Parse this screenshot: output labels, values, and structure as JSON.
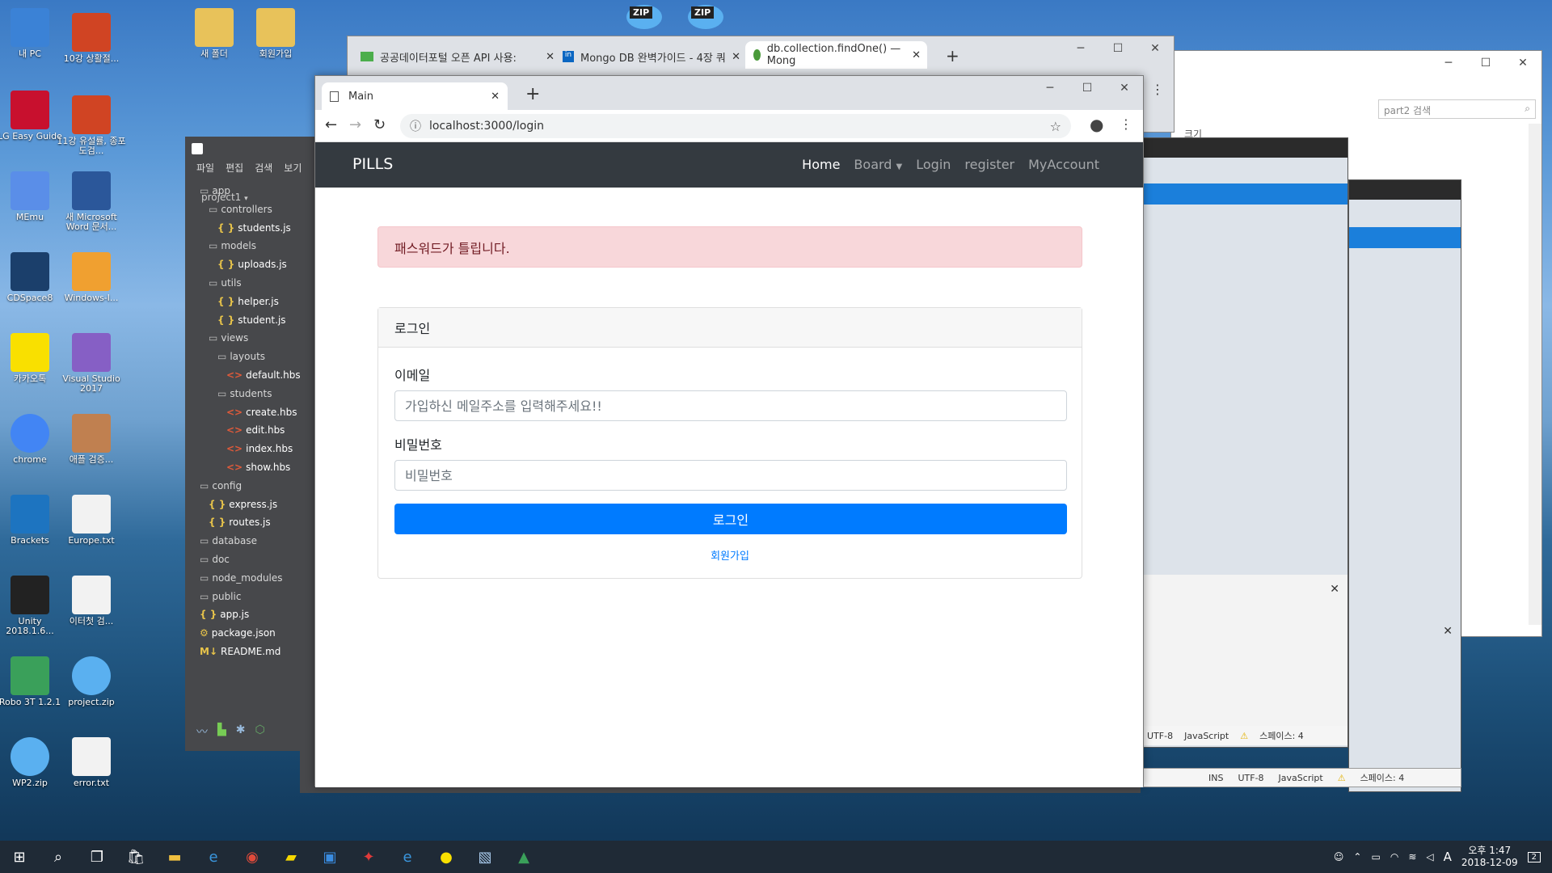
{
  "desktop_icons": [
    {
      "label": "내 PC",
      "icon": "pc-icon",
      "color": "#3b82d6"
    },
    {
      "label": "10강 상활절...",
      "icon": "ppt-icon",
      "color": "#d04423"
    },
    {
      "label": "새 폴더",
      "icon": "folder-icon",
      "color": "#e8c25a"
    },
    {
      "label": "회원가입",
      "icon": "folder-icon",
      "color": "#e8c25a"
    },
    {
      "label": "LG Easy Guide",
      "icon": "lg-icon",
      "color": "#c8102e"
    },
    {
      "label": "11강 유설률, 종포도검...",
      "icon": "ppt-icon",
      "color": "#d04423"
    },
    {
      "label": "MEmu",
      "icon": "memu-icon",
      "color": "#5a8ee8"
    },
    {
      "label": "새 Microsoft Word 문서...",
      "icon": "word-icon",
      "color": "#2b579a"
    },
    {
      "label": "CDSpace8",
      "icon": "cdspace-icon",
      "color": "#1b3f6b"
    },
    {
      "label": "Windows-I...",
      "icon": "helpdoc-icon",
      "color": "#f0a030"
    },
    {
      "label": "카카오톡",
      "icon": "kakaotalk-icon",
      "color": "#f9e000"
    },
    {
      "label": "Visual Studio 2017",
      "icon": "visual-studio-icon",
      "color": "#865fc5"
    },
    {
      "label": "chrome",
      "icon": "chrome-icon",
      "color": "#4285f4"
    },
    {
      "label": "애플 검증...",
      "icon": "image-icon",
      "color": "#c08050"
    },
    {
      "label": "Brackets",
      "icon": "brackets-icon",
      "color": "#1d74c0"
    },
    {
      "label": "Europe.txt",
      "icon": "text-file-icon",
      "color": "#f2f2f2"
    },
    {
      "label": "Unity 2018.1.6...",
      "icon": "unity-icon",
      "color": "#222222"
    },
    {
      "label": "이터첫 검...",
      "icon": "text-file-icon",
      "color": "#f2f2f2"
    },
    {
      "label": "Robo 3T 1.2.1",
      "icon": "robo3t-icon",
      "color": "#3aa05a"
    },
    {
      "label": "project.zip",
      "icon": "zip-icon",
      "color": "#5ab0f0"
    },
    {
      "label": "WP2.zip",
      "icon": "zip-icon",
      "color": "#5ab0f0"
    },
    {
      "label": "error.txt",
      "icon": "text-file-icon",
      "color": "#f2f2f2"
    }
  ],
  "top_zips": [
    "ZIP",
    "ZIP"
  ],
  "back_browser": {
    "tabs": [
      "공공데이터포털 오픈 API 사용:",
      "Mongo DB 완벽가이드 - 4장 쿼",
      "db.collection.findOne() — Mong"
    ]
  },
  "explorer": {
    "search_placeholder": "part2 검색",
    "text": "크기"
  },
  "editor": {
    "menu": [
      "파일",
      "편집",
      "검색",
      "보기"
    ],
    "project": "project1",
    "tree": [
      {
        "label": "app",
        "type": "folder",
        "depth": 0
      },
      {
        "label": "controllers",
        "type": "folder",
        "depth": 1
      },
      {
        "label": "students.js",
        "type": "js",
        "depth": 2
      },
      {
        "label": "models",
        "type": "folder",
        "depth": 1
      },
      {
        "label": "uploads.js",
        "type": "js",
        "depth": 2
      },
      {
        "label": "utils",
        "type": "folder",
        "depth": 1
      },
      {
        "label": "helper.js",
        "type": "js",
        "depth": 2
      },
      {
        "label": "student.js",
        "type": "js",
        "depth": 2
      },
      {
        "label": "views",
        "type": "folder",
        "depth": 1
      },
      {
        "label": "layouts",
        "type": "folder",
        "depth": 2
      },
      {
        "label": "default.hbs",
        "type": "hbs",
        "depth": 3
      },
      {
        "label": "students",
        "type": "folder",
        "depth": 2
      },
      {
        "label": "create.hbs",
        "type": "hbs",
        "depth": 3
      },
      {
        "label": "edit.hbs",
        "type": "hbs",
        "depth": 3
      },
      {
        "label": "index.hbs",
        "type": "hbs",
        "depth": 3
      },
      {
        "label": "show.hbs",
        "type": "hbs",
        "depth": 3
      },
      {
        "label": "config",
        "type": "folder",
        "depth": 0
      },
      {
        "label": "express.js",
        "type": "js",
        "depth": 1
      },
      {
        "label": "routes.js",
        "type": "js",
        "depth": 1
      },
      {
        "label": "database",
        "type": "folder",
        "depth": 0
      },
      {
        "label": "doc",
        "type": "folder",
        "depth": 0
      },
      {
        "label": "node_modules",
        "type": "folder",
        "depth": 0
      },
      {
        "label": "public",
        "type": "folder",
        "depth": 0
      },
      {
        "label": "app.js",
        "type": "js",
        "depth": 0
      },
      {
        "label": "package.json",
        "type": "json",
        "depth": 0
      },
      {
        "label": "README.md",
        "type": "md",
        "depth": 0
      }
    ]
  },
  "status_bars": [
    {
      "encoding": "UTF-8",
      "language": "JavaScript",
      "spaces": "스페이스: 4"
    },
    {
      "ins": "INS",
      "encoding": "UTF-8",
      "language": "JavaScript",
      "spaces": "스페이스: 4"
    }
  ],
  "browser": {
    "tab_title": "Main",
    "url": "localhost:3000/login",
    "navbar": {
      "brand": "PILLS",
      "items": [
        "Home",
        "Board",
        "Login",
        "register",
        "MyAccount"
      ]
    },
    "alert": "패스워드가 틀립니다.",
    "card": {
      "header": "로그인",
      "email_label": "이메일",
      "email_placeholder": "가입하신 메일주소를 입력해주세요!!",
      "password_label": "비밀번호",
      "password_placeholder": "비밀번호",
      "submit": "로그인",
      "signup_link": "회원가입"
    }
  },
  "taskbar": {
    "time": "오후 1:47",
    "date": "2018-12-09",
    "ime": "A",
    "notification_count": "2"
  }
}
